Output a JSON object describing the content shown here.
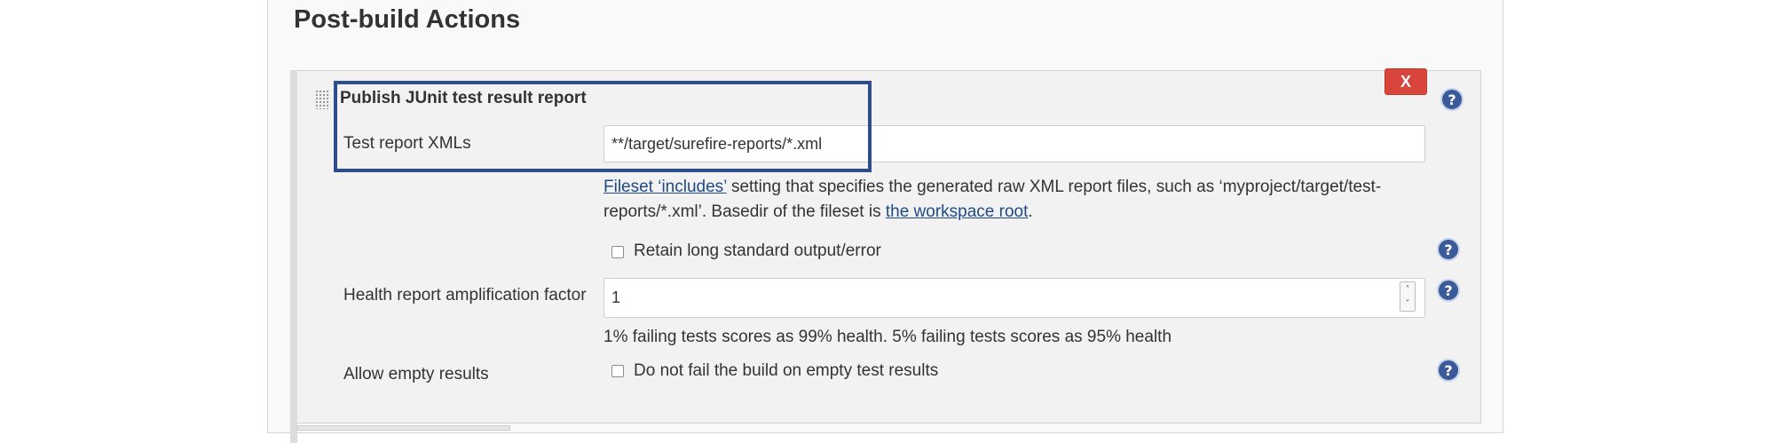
{
  "section": {
    "title": "Post-build Actions"
  },
  "junit": {
    "title": "Publish JUnit test result report",
    "delete_label": "X",
    "help_glyph": "?",
    "test_report": {
      "label": "Test report XMLs",
      "value": "**/target/surefire-reports/*.xml",
      "desc_link1": "Fileset ‘includes’",
      "desc_text1": " setting that specifies the generated raw XML report files, such as ‘myproject/target/test-",
      "desc_text2": "reports/*.xml’. Basedir of the fileset is ",
      "desc_link2": "the workspace root",
      "desc_text3": "."
    },
    "retain": {
      "label": "Retain long standard output/error",
      "checked": false
    },
    "health": {
      "label": "Health report amplification factor",
      "value": "1",
      "spin_up": "˄",
      "spin_down": "˅",
      "desc": "1% failing tests scores as 99% health. 5% failing tests scores as 95% health"
    },
    "allow_empty": {
      "label": "Allow empty results",
      "checkbox_label": "Do not fail the build on empty test results",
      "checked": false
    }
  },
  "colors": {
    "highlight": "#2e4d8d",
    "delete": "#d9453d",
    "help": "#3a5a9a",
    "link": "#204a87"
  },
  "icons": [
    "drag-handle-icon",
    "help-icon",
    "close-icon",
    "spinner-up-icon",
    "spinner-down-icon"
  ]
}
